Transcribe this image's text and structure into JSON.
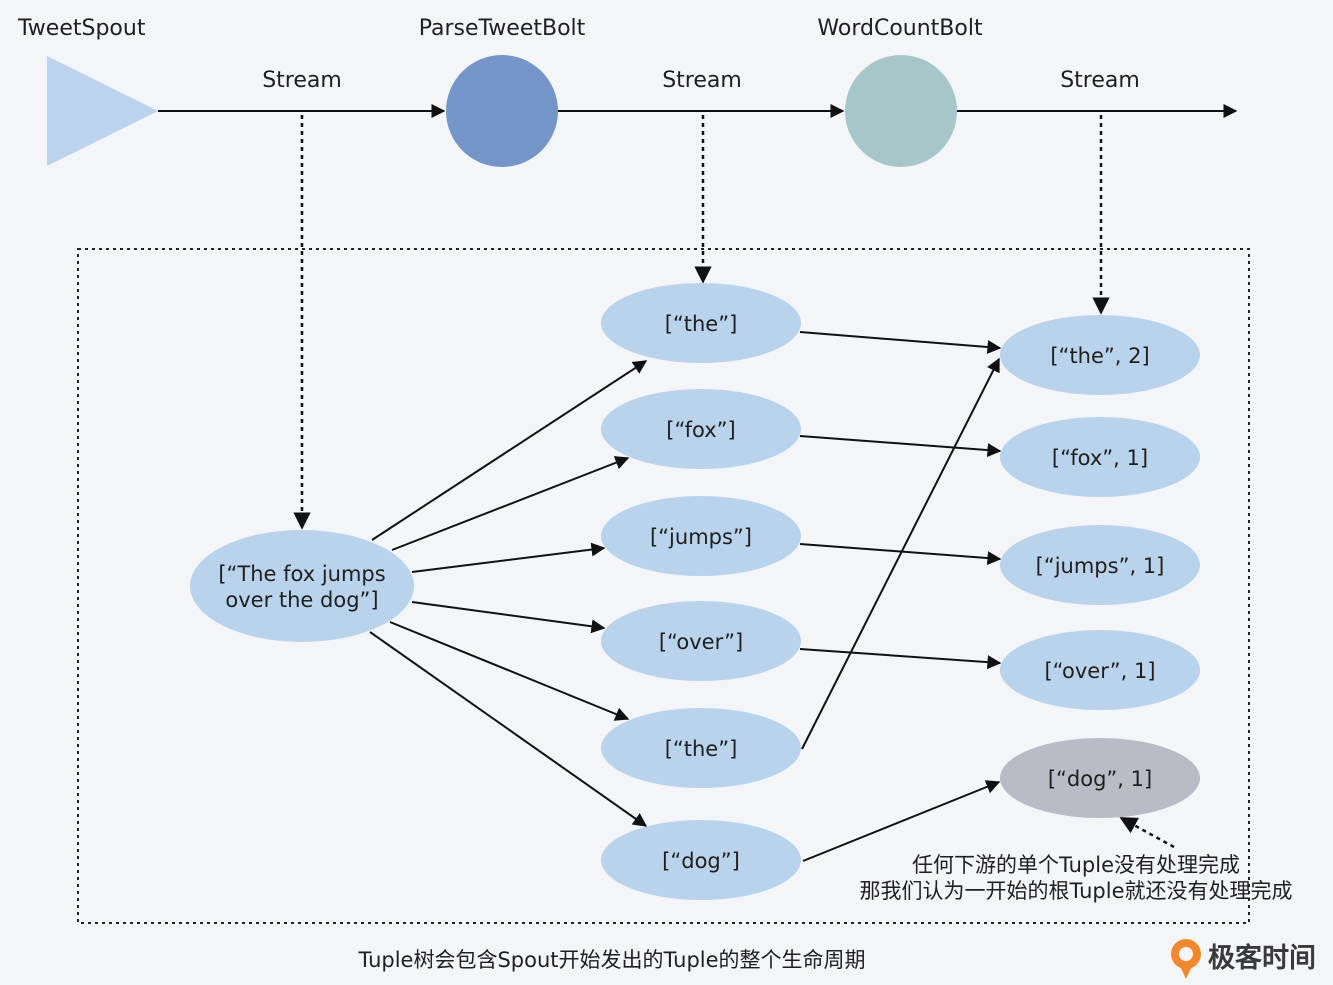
{
  "topology": {
    "spout_label": "TweetSpout",
    "parse_bolt_label": "ParseTweetBolt",
    "count_bolt_label": "WordCountBolt",
    "stream_label_1": "Stream",
    "stream_label_2": "Stream",
    "stream_label_3": "Stream"
  },
  "root_tuple": {
    "line1": "[“The fox jumps",
    "line2": "over the dog”]"
  },
  "word_tuples": [
    "[“the”]",
    "[“fox”]",
    "[“jumps”]",
    "[“over”]",
    "[“the”]",
    "[“dog”]"
  ],
  "count_tuples": [
    "[“the”, 2]",
    "[“fox”, 1]",
    "[“jumps”, 1]",
    "[“over”, 1]",
    "[“dog”, 1]"
  ],
  "note": {
    "line1": "任何下游的单个Tuple没有处理完成",
    "line2": "那我们认为一开始的根Tuple就还没有处理完成"
  },
  "caption": "Tuple树会包含Spout开始发出的Tuple的整个生命周期",
  "brand": "极客时间",
  "colors": {
    "spout": "#bcd3ec",
    "parse_bolt": "#7595c8",
    "count_bolt": "#a7c6c9",
    "tuple": "#b9d3ec",
    "failed_tuple": "#b9bcc4"
  }
}
